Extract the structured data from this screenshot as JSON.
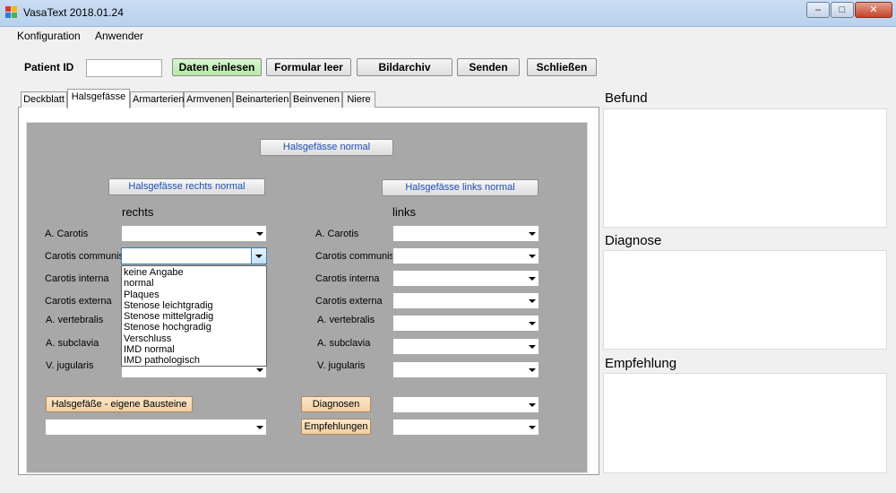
{
  "window": {
    "title": "VasaText  2018.01.24",
    "controls": {
      "minimize": "–",
      "maximize": "□",
      "close": "✕"
    }
  },
  "menu": {
    "items": [
      "Konfiguration",
      "Anwender"
    ]
  },
  "toolbar": {
    "patient_id_label": "Patient ID",
    "patient_id_value": "",
    "buttons": {
      "daten_einlesen": "Daten einlesen",
      "formular_leer": "Formular leer",
      "bildarchiv": "Bildarchiv",
      "senden": "Senden",
      "schliessen": "Schließen"
    }
  },
  "tabs": [
    "Deckblatt",
    "Halsgefässe",
    "Armarterien",
    "Armvenen",
    "Beinarterien",
    "Beinvenen",
    "Niere"
  ],
  "active_tab": "Halsgefässe",
  "panel": {
    "normal_button": "Halsgefässe normal",
    "rechts_normal_button": "Halsgefässe rechts  normal",
    "links_normal_button": "Halsgefässe links normal",
    "rechts_heading": "rechts",
    "links_heading": "links",
    "rows_rechts": [
      "A. Carotis",
      "Carotis communis",
      "Carotis interna",
      "Carotis externa",
      "A. vertebralis",
      "A. subclavia",
      "V. jugularis"
    ],
    "rows_links": [
      "A. Carotis",
      "Carotis communis",
      "Carotis interna",
      "Carotis externa",
      "A. vertebralis",
      "A. subclavia",
      "V. jugularis"
    ],
    "dropdown_options": [
      "keine Angabe",
      "normal",
      "Plaques",
      "Stenose leichtgradig",
      "Stenose mittelgradig",
      "Stenose hochgradig",
      "Verschluss",
      "IMD normal",
      "IMD pathologisch"
    ],
    "eigene_bausteine_button": "Halsgefäße - eigene Bausteine",
    "diagnosen_button": "Diagnosen",
    "empfehlungen_button": "Empfehlungen"
  },
  "right": {
    "befund": "Befund",
    "diagnose": "Diagnose",
    "empfehlung": "Empfehlung"
  }
}
